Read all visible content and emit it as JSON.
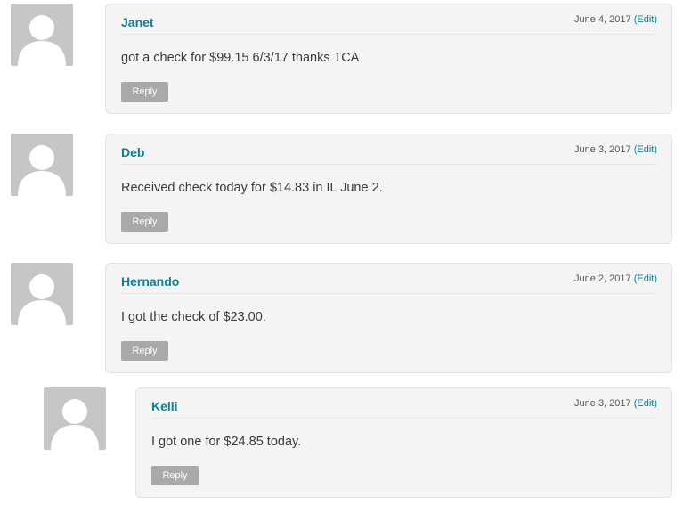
{
  "comments": [
    {
      "author": "Janet",
      "date": "June 4, 2017",
      "edit_label": "(Edit)",
      "text": "got a check for $99.15 6/3/17 thanks TCA",
      "reply_label": "Reply",
      "avatar_icon": "default-avatar-icon"
    },
    {
      "author": "Deb",
      "date": "June 3, 2017",
      "edit_label": "(Edit)",
      "text": "Received check today for $14.83 in IL June 2.",
      "reply_label": "Reply",
      "avatar_icon": "default-avatar-icon"
    },
    {
      "author": "Hernando",
      "date": "June 2, 2017",
      "edit_label": "(Edit)",
      "text": "I got the check of $23.00.",
      "reply_label": "Reply",
      "avatar_icon": "default-avatar-icon"
    },
    {
      "author": "Kelli",
      "date": "June 3, 2017",
      "edit_label": "(Edit)",
      "text": "I got one for $24.85 today.",
      "reply_label": "Reply",
      "avatar_icon": "default-avatar-icon",
      "is_reply_to": "Hernando"
    }
  ],
  "colors": {
    "author": "#0f7f91",
    "box_background": "#f4f4f4",
    "reply_button": "#a9a9a9",
    "avatar_background": "#c6c6c6"
  }
}
